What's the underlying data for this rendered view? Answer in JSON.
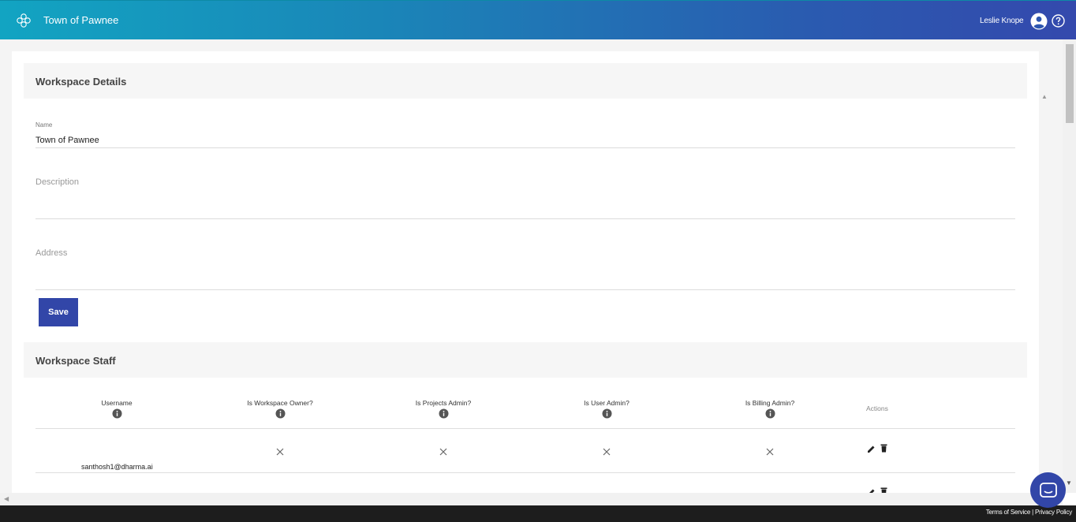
{
  "header": {
    "app_title": "Town of Pawnee",
    "user_name": "Leslie Knope",
    "logo_icon": "flower-logo-icon",
    "user_icon": "account-circle-icon",
    "help_icon": "help-circle-icon"
  },
  "workspace_details": {
    "heading": "Workspace Details",
    "name_label": "Name",
    "name_value": "Town of Pawnee",
    "description_label": "Description",
    "description_value": "",
    "address_label": "Address",
    "address_value": "",
    "save_label": "Save"
  },
  "workspace_staff": {
    "heading": "Workspace Staff",
    "columns": [
      "Username",
      "Is Workspace Owner?",
      "Is Projects Admin?",
      "Is User Admin?",
      "Is Billing Admin?",
      "Actions"
    ],
    "rows": [
      {
        "username": "santhosh1@dharma.ai",
        "is_owner": false,
        "is_projects_admin": false,
        "is_user_admin": false,
        "is_billing_admin": false
      }
    ]
  },
  "footer": {
    "terms": "Terms of Service",
    "privacy": "Privacy Policy"
  },
  "colors": {
    "header_start": "#12a4c2",
    "header_end": "#3449ad",
    "primary_button": "#3246a8"
  }
}
